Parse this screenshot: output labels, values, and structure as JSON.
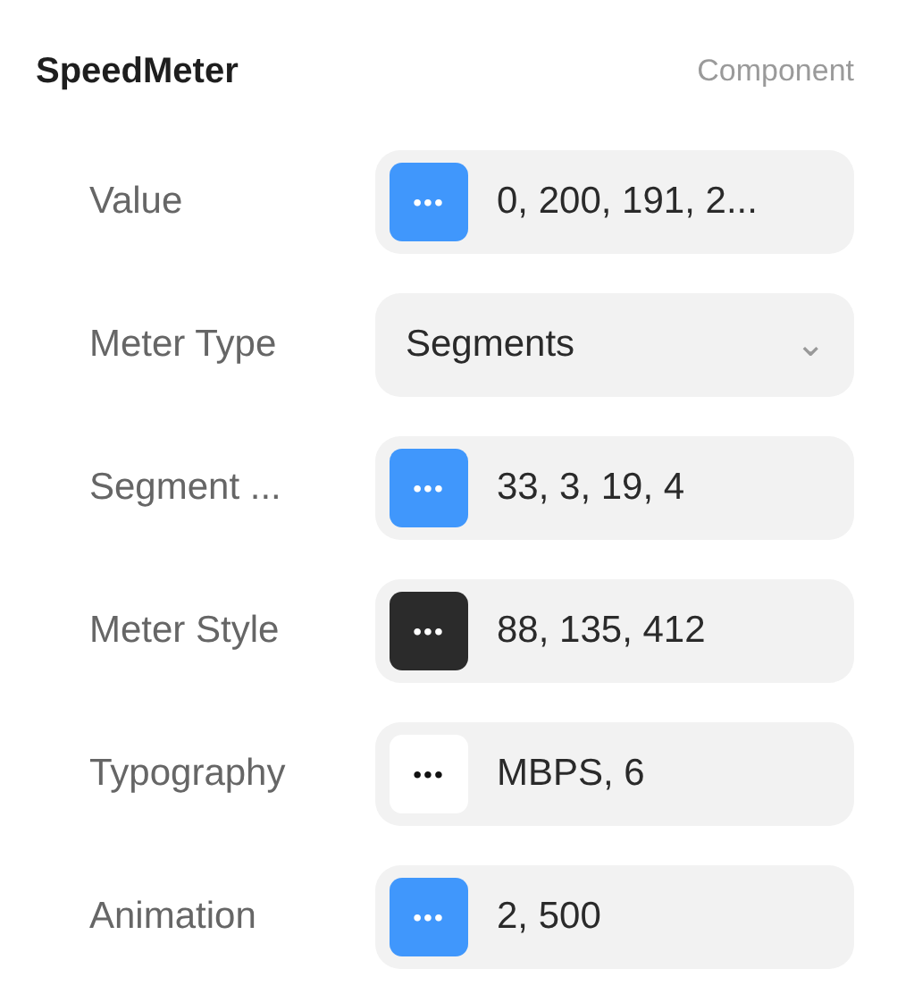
{
  "header": {
    "title": "SpeedMeter",
    "type_label": "Component"
  },
  "properties": [
    {
      "label": "Value",
      "kind": "swatch",
      "color": "#4097fc",
      "icon": "•••",
      "value": "0, 200, 191, 2..."
    },
    {
      "label": "Meter Type",
      "kind": "select",
      "value": "Segments",
      "icon": "⌄"
    },
    {
      "label": "Segment ...",
      "kind": "swatch",
      "color": "#4097fc",
      "icon": "•••",
      "value": "33, 3, 19, 4"
    },
    {
      "label": "Meter Style",
      "kind": "swatch",
      "color": "#2b2b2b",
      "icon": "•••",
      "value": "88, 135, 412"
    },
    {
      "label": "Typography",
      "kind": "swatch",
      "color": "#ffffff",
      "icon": "•••",
      "value": "MBPS, 6"
    },
    {
      "label": "Animation",
      "kind": "swatch",
      "color": "#4097fc",
      "icon": "•••",
      "value": "2, 500"
    }
  ]
}
